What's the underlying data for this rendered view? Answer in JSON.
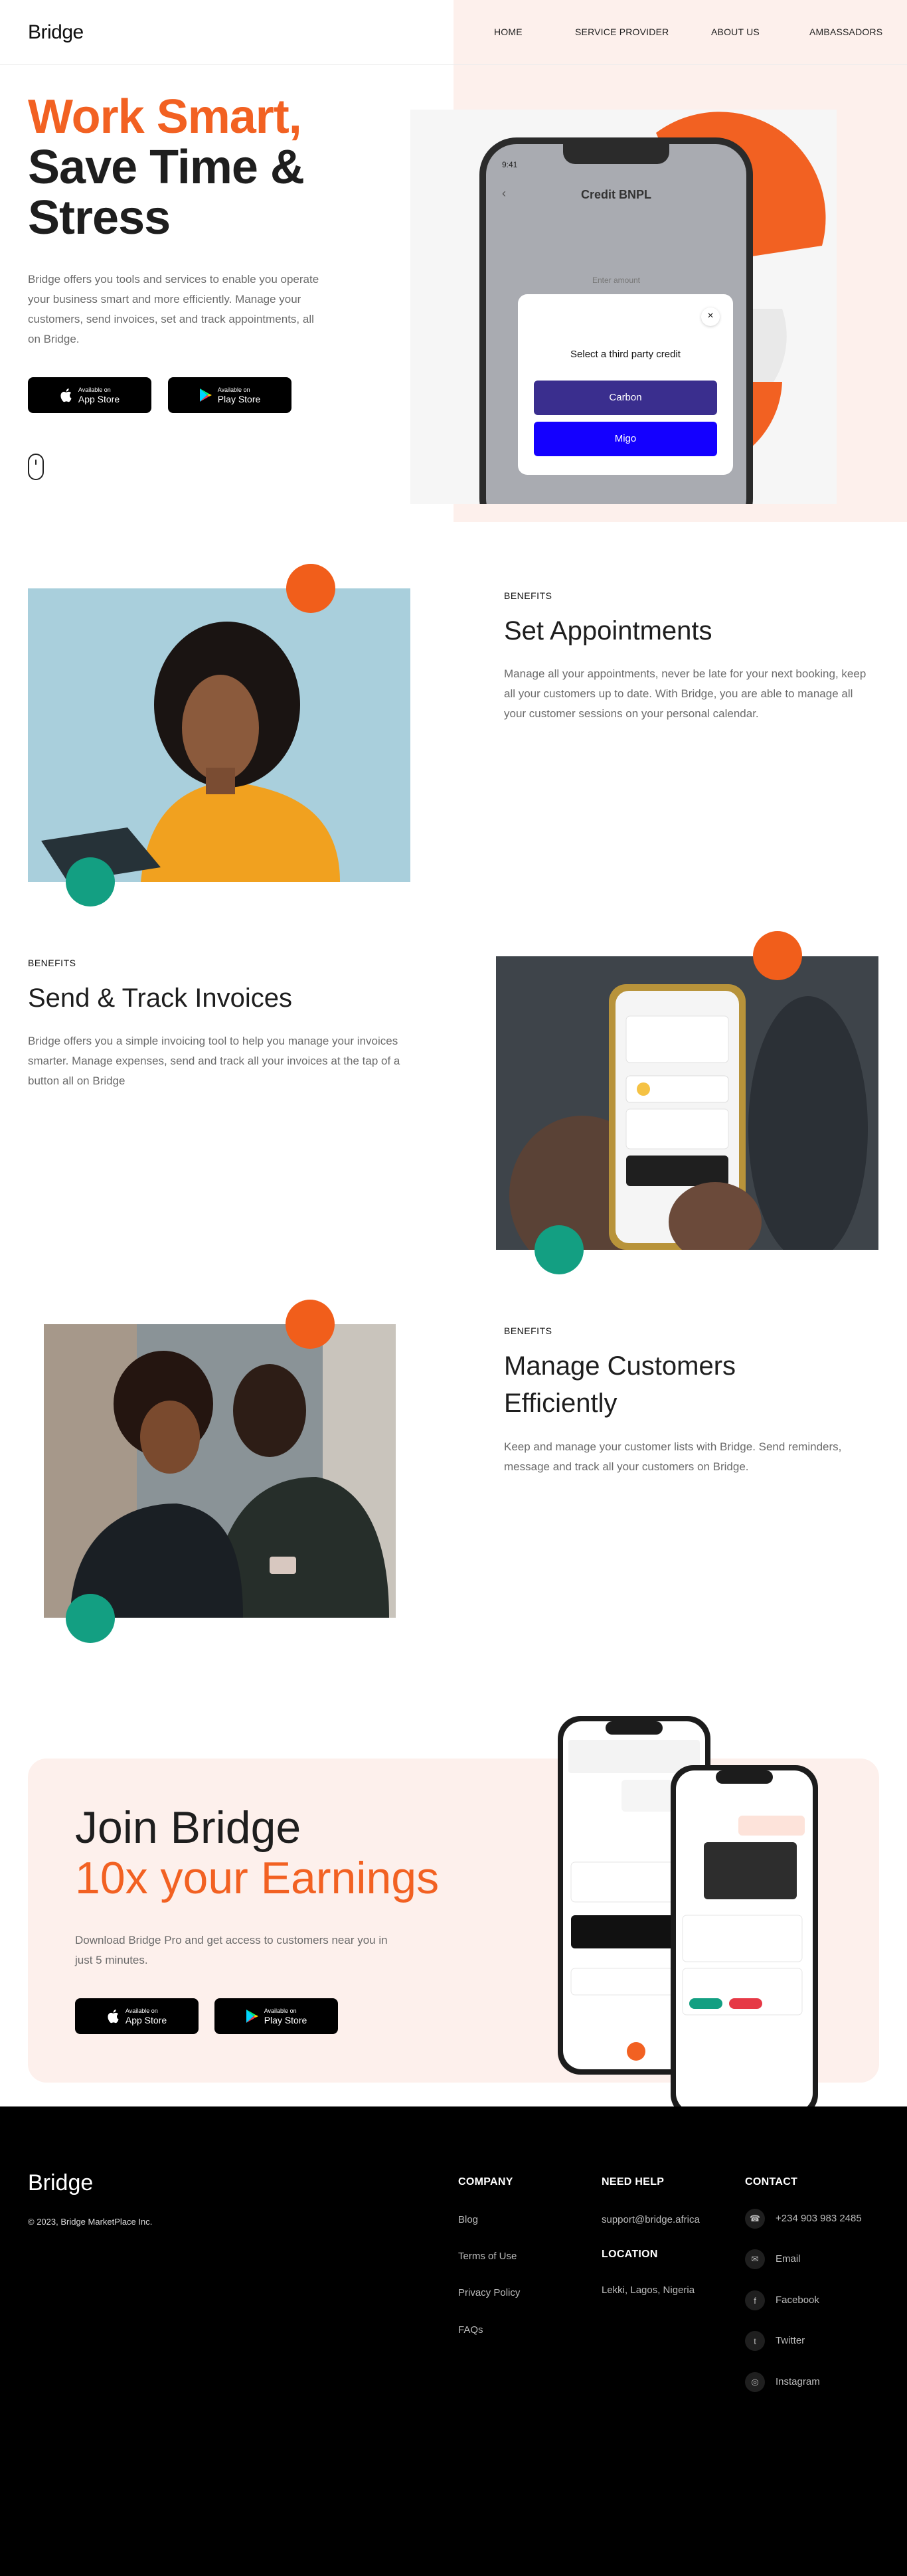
{
  "header": {
    "logo": "Bridge",
    "nav": [
      "HOME",
      "SERVICE PROVIDER",
      "ABOUT US",
      "AMBASSADORS"
    ]
  },
  "hero": {
    "title_line1": "Work Smart,",
    "title_line2": "Save Time &",
    "title_line3": "Stress",
    "description": "Bridge offers you tools and services to enable you operate your business smart and more efficiently. Manage your customers, send invoices, set and track appointments, all on Bridge.",
    "app_store": {
      "small": "Available on",
      "big": "App Store"
    },
    "play_store": {
      "small": "Available on",
      "big": "Play Store"
    }
  },
  "phone_mock": {
    "time": "9:41",
    "title": "Credit BNPL",
    "field_label": "Enter amount",
    "modal_close": "×",
    "modal_title": "Select a third party credit",
    "options": [
      "Carbon",
      "Migo"
    ]
  },
  "features": [
    {
      "eyebrow": "BENEFITS",
      "title": "Set Appointments",
      "text": "Manage all your appointments, never be late for your next booking, keep all your customers up to date. With Bridge, you are able to manage all your customer sessions on your personal calendar."
    },
    {
      "eyebrow": "BENEFITS",
      "title": "Send & Track Invoices",
      "text": "Bridge offers you a simple invoicing tool to help you manage your invoices smarter. Manage expenses, send and track all your invoices at the tap of a button all on Bridge"
    },
    {
      "eyebrow": "BENEFITS",
      "title_line1": "Manage Customers",
      "title_line2": "Efficiently",
      "text": "Keep and manage your customer lists with Bridge. Send reminders, message and track all your customers on Bridge."
    }
  ],
  "join": {
    "title_line1": "Join Bridge",
    "title_line2": "10x your Earnings",
    "text": "Download Bridge Pro and get access to customers near you in just 5 minutes.",
    "app_store": {
      "small": "Available on",
      "big": "App Store"
    },
    "play_store": {
      "small": "Available on",
      "big": "Play Store"
    }
  },
  "footer": {
    "logo": "Bridge",
    "copyright": "© 2023, Bridge MarketPlace Inc.",
    "company_head": "COMPANY",
    "company_links": [
      "Blog",
      "Terms of Use",
      "Privacy Policy",
      "FAQs"
    ],
    "help_head": "NEED HELP",
    "help_email": "support@bridge.africa",
    "location_head": "LOCATION",
    "location": "Lekki, Lagos, Nigeria",
    "contact_head": "CONTACT",
    "contacts": [
      {
        "icon": "phone-icon",
        "label": "+234 903 983 2485"
      },
      {
        "icon": "email-icon",
        "label": "Email"
      },
      {
        "icon": "facebook-icon",
        "label": "Facebook"
      },
      {
        "icon": "twitter-icon",
        "label": "Twitter"
      },
      {
        "icon": "instagram-icon",
        "label": "Instagram"
      }
    ]
  },
  "colors": {
    "accent": "#f26122",
    "green": "#139f82",
    "purple": "#3a2e8e",
    "blue": "#1400ff"
  }
}
